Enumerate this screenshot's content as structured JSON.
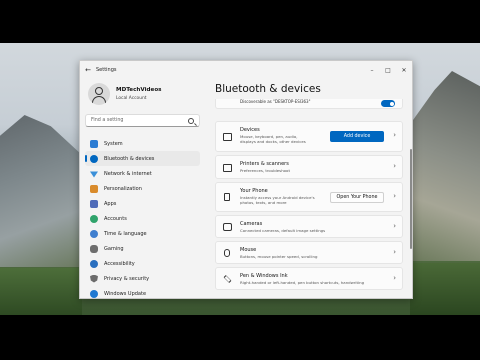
{
  "window": {
    "title": "Settings"
  },
  "profile": {
    "name": "MDTechVideos",
    "account": "Local Account"
  },
  "search": {
    "placeholder": "Find a setting"
  },
  "nav": [
    {
      "label": "System",
      "color": "#2b7cd3"
    },
    {
      "label": "Bluetooth & devices",
      "color": "#0067c0",
      "active": true
    },
    {
      "label": "Network & internet",
      "color": "#3a8fd8"
    },
    {
      "label": "Personalization",
      "color": "#d98b2b"
    },
    {
      "label": "Apps",
      "color": "#4f6bb8"
    },
    {
      "label": "Accounts",
      "color": "#2fa36b"
    },
    {
      "label": "Time & language",
      "color": "#3f7fcf"
    },
    {
      "label": "Gaming",
      "color": "#6d6d6d"
    },
    {
      "label": "Accessibility",
      "color": "#2a6fbf"
    },
    {
      "label": "Privacy & security",
      "color": "#6b6b6b"
    },
    {
      "label": "Windows Update",
      "color": "#1f78d1"
    }
  ],
  "main": {
    "title": "Bluetooth & devices",
    "discoverable": "Discoverable as \"DESKTOP-ESI363\"",
    "toggle_state": "On",
    "cards": {
      "devices": {
        "title": "Devices",
        "subtitle": "Mouse, keyboard, pen, audio, displays and docks, other devices",
        "button": "Add device"
      },
      "printers": {
        "title": "Printers & scanners",
        "subtitle": "Preferences, troubleshoot"
      },
      "phone": {
        "title": "Your Phone",
        "subtitle": "Instantly access your Android device's photos, texts, and more",
        "button": "Open Your Phone"
      },
      "cameras": {
        "title": "Cameras",
        "subtitle": "Connected cameras, default image settings"
      },
      "mouse": {
        "title": "Mouse",
        "subtitle": "Buttons, mouse pointer speed, scrolling"
      },
      "pen": {
        "title": "Pen & Windows Ink",
        "subtitle": "Right-handed or left-handed, pen button shortcuts, handwriting"
      }
    }
  },
  "colors": {
    "accent": "#0067c0"
  }
}
